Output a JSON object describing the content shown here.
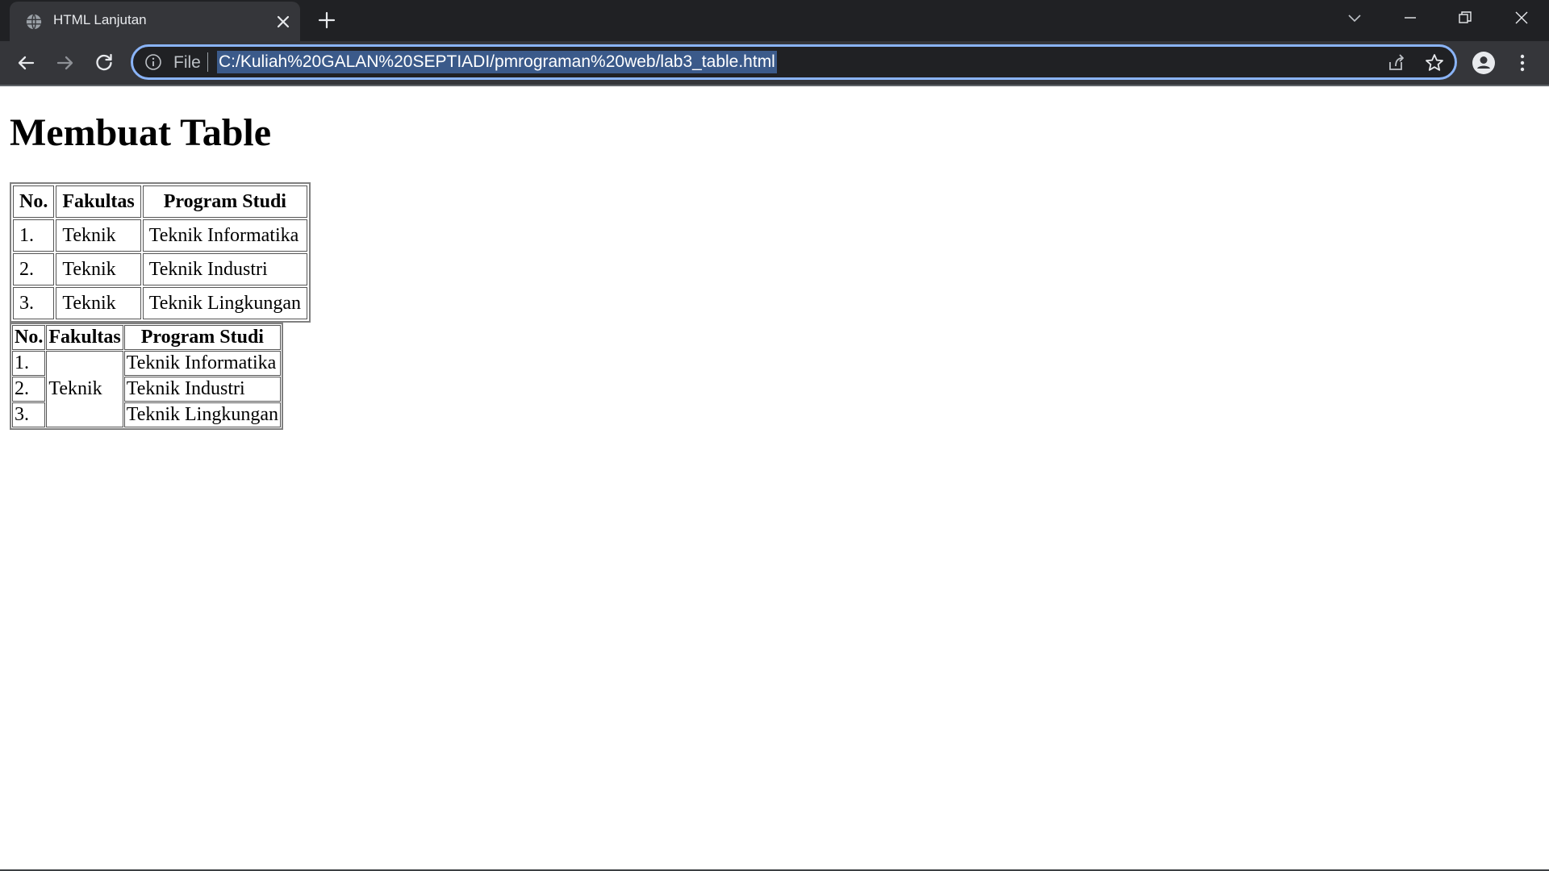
{
  "browser": {
    "tab_title": "HTML Lanjutan",
    "address_scheme": "File",
    "address_url": "C:/Kuliah%20GALAN%20SEPTIADI/pmrograman%20web/lab3_table.html",
    "accent_color": "#8ab4f8"
  },
  "icons": {
    "tab_favicon": "globe-icon",
    "tab_close": "close-icon",
    "new_tab": "plus-icon",
    "tab_search": "chevron-down-icon",
    "minimize": "minimize-icon",
    "restore": "restore-icon",
    "window_close": "close-icon",
    "back": "arrow-left-icon",
    "forward": "arrow-right-icon",
    "reload": "reload-icon",
    "site_info": "info-icon",
    "share": "share-icon",
    "bookmark": "star-icon",
    "profile": "person-icon",
    "menu": "kebab-menu-icon"
  },
  "page": {
    "heading": "Membuat Table",
    "table1": {
      "headers": [
        "No.",
        "Fakultas",
        "Program Studi"
      ],
      "rows": [
        [
          "1.",
          "Teknik",
          "Teknik Informatika"
        ],
        [
          "2.",
          "Teknik",
          "Teknik Industri"
        ],
        [
          "3.",
          "Teknik",
          "Teknik Lingkungan"
        ]
      ]
    },
    "table2": {
      "headers": [
        "No.",
        "Fakultas",
        "Program Studi"
      ],
      "numbers": [
        "1.",
        "2.",
        "3."
      ],
      "fakultas_merged": "Teknik",
      "programs": [
        "Teknik Informatika",
        "Teknik Industri",
        "Teknik Lingkungan"
      ]
    }
  }
}
